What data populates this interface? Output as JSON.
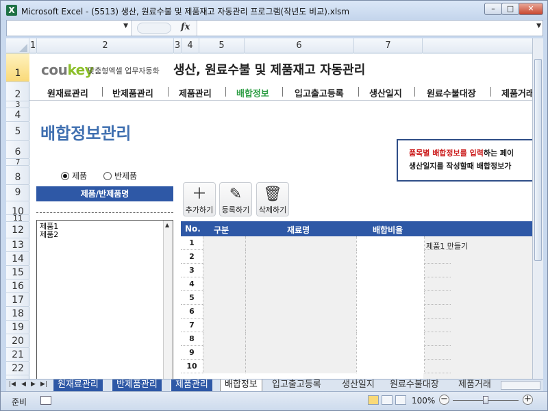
{
  "window": {
    "title": "Microsoft Excel - (5513) 생산, 원료수불 및 제품재고 자동관리 프로그램(작년도 비교).xlsm",
    "app_icon": "X",
    "minimize_icon": "–",
    "restore_icon": "□",
    "close_icon": "✕"
  },
  "formula_bar": {
    "name_box": "",
    "fx_label": "fx",
    "formula": ""
  },
  "grid": {
    "columns": [
      "1",
      "2",
      "3",
      "4",
      "5",
      "6",
      "7"
    ],
    "rows": [
      "1",
      "2",
      "3",
      "4",
      "5",
      "6",
      "7",
      "8",
      "9",
      "10",
      "11",
      "12",
      "13",
      "14",
      "15",
      "16",
      "17",
      "18",
      "19",
      "20",
      "21",
      "22"
    ]
  },
  "header": {
    "logo_main": "cou",
    "logo_key": "key",
    "logo_sub": "맞춤형엑셀 업무자동화",
    "app_title": "생산, 원료수불 및 제품재고 자동관리"
  },
  "menu": {
    "items": [
      "원재료관리",
      "반제품관리",
      "제품관리",
      "배합정보",
      "입고출고등록",
      "생산일지",
      "원료수불대장",
      "제품거래"
    ],
    "active_index": 3
  },
  "page_title": "배합정보관리",
  "notice": {
    "line1_red": "품목별 배합정보를 입력",
    "line1_rest": "하는 페이",
    "line2": "생산일지를 작성할때 배합정보가"
  },
  "product_selector": {
    "radio_product": "제품",
    "radio_semi": "반제품",
    "selected": "제품",
    "list_header": "제품/반제품명",
    "items": [
      "제품1",
      "제품2"
    ]
  },
  "toolbar": {
    "add_label": "추가하기",
    "register_label": "등록하기",
    "delete_label": "삭제하기"
  },
  "mix_table": {
    "columns": [
      "No.",
      "구분",
      "재료명",
      "배합비율"
    ],
    "row_numbers": [
      "1",
      "2",
      "3",
      "4",
      "5",
      "6",
      "7",
      "8",
      "9",
      "10"
    ],
    "caption": "제품1 만들기"
  },
  "sheet_tabs": {
    "tabs": [
      "원재료관리",
      "반제품관리",
      "제품관리",
      "배합정보",
      "입고출고등록",
      "생산일지",
      "원료수불대장",
      "제품거래"
    ],
    "active": "배합정보"
  },
  "status_bar": {
    "ready": "준비",
    "zoom": "100%",
    "zoom_value": 1.0
  }
}
